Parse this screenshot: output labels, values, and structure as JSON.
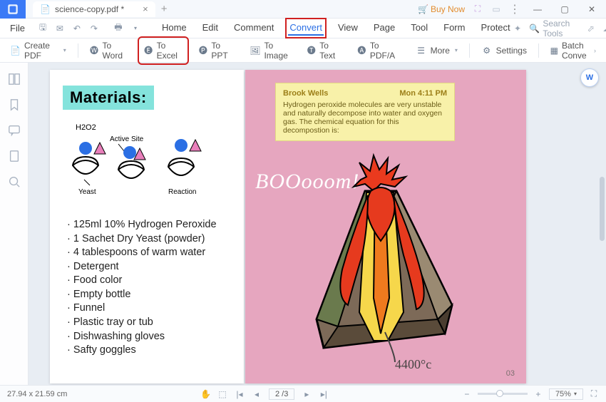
{
  "titlebar": {
    "filename": "science-copy.pdf *",
    "buy_now": "Buy Now"
  },
  "menubar": {
    "file": "File",
    "tabs": [
      "Home",
      "Edit",
      "Comment",
      "Convert",
      "View",
      "Page",
      "Tool",
      "Form",
      "Protect"
    ],
    "active": "Convert",
    "search_placeholder": "Search Tools"
  },
  "toolbar": {
    "create_pdf": "Create PDF",
    "to_word": "To Word",
    "to_excel": "To Excel",
    "to_ppt": "To PPT",
    "to_image": "To Image",
    "to_text": "To Text",
    "to_pdfa": "To PDF/A",
    "more": "More",
    "settings": "Settings",
    "batch": "Batch Conve"
  },
  "document": {
    "materials_heading": "Materials:",
    "doodle_labels": {
      "h2o2": "H2O2",
      "active_site": "Active Site",
      "yeast": "Yeast",
      "reaction": "Reaction"
    },
    "materials_list": [
      "125ml 10% Hydrogen Peroxide",
      "1 Sachet Dry Yeast (powder)",
      "4 tablespoons of warm water",
      "Detergent",
      "Food color",
      "Empty bottle",
      "Funnel",
      "Plastic tray or tub",
      "Dishwashing gloves",
      "Safty goggles"
    ],
    "note": {
      "author": "Brook Wells",
      "time": "Mon 4:11 PM",
      "body": "Hydrogen peroxide molecules are very unstable and naturally decompose into water and oxygen gas. The chemical equation for this decompostion is:"
    },
    "boom_text": "BOOooom!",
    "temperature": "4400°c",
    "page_number": "03"
  },
  "statusbar": {
    "dimensions": "27.94 x 21.59 cm",
    "page_indicator": "2 /3",
    "zoom": "75%"
  }
}
